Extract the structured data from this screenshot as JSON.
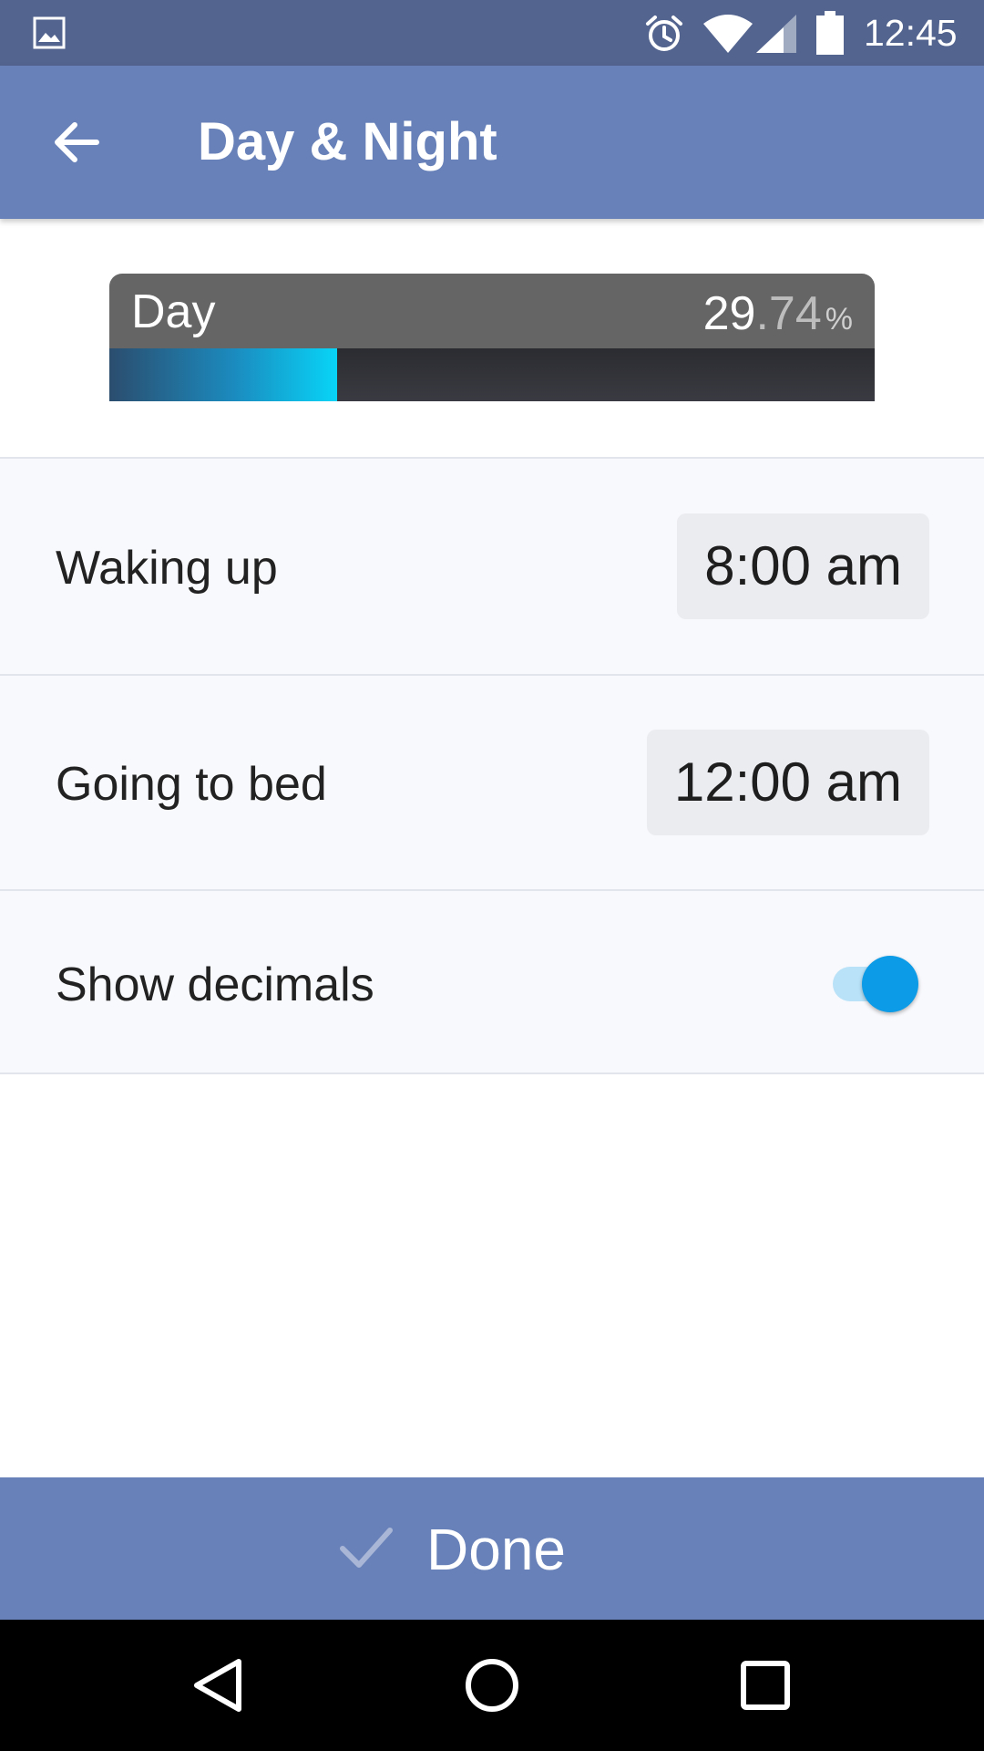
{
  "status_bar": {
    "time": "12:45",
    "icons": [
      "gallery-icon",
      "alarm-icon",
      "wifi-icon",
      "signal-icon",
      "battery-icon"
    ]
  },
  "toolbar": {
    "title": "Day & Night",
    "back_icon": "arrow-left-icon"
  },
  "progress": {
    "label": "Day",
    "value_integer": "29",
    "value_decimal": ".74",
    "value_unit": "%",
    "fraction": 0.2974,
    "fill_color": "#08d4f7"
  },
  "settings": {
    "waking_up": {
      "label": "Waking up",
      "value": "8:00 am"
    },
    "going_to_bed": {
      "label": "Going to bed",
      "value": "12:00 am"
    },
    "show_decimals": {
      "label": "Show decimals",
      "enabled": true
    }
  },
  "done_bar": {
    "label": "Done",
    "icon": "check-icon"
  },
  "colors": {
    "status_bar": "#53648f",
    "toolbar": "#6882b9",
    "toggle_accent": "#0c9be6"
  },
  "nav_bar": {
    "buttons": [
      "back-triangle-icon",
      "home-circle-icon",
      "recents-square-icon"
    ]
  }
}
